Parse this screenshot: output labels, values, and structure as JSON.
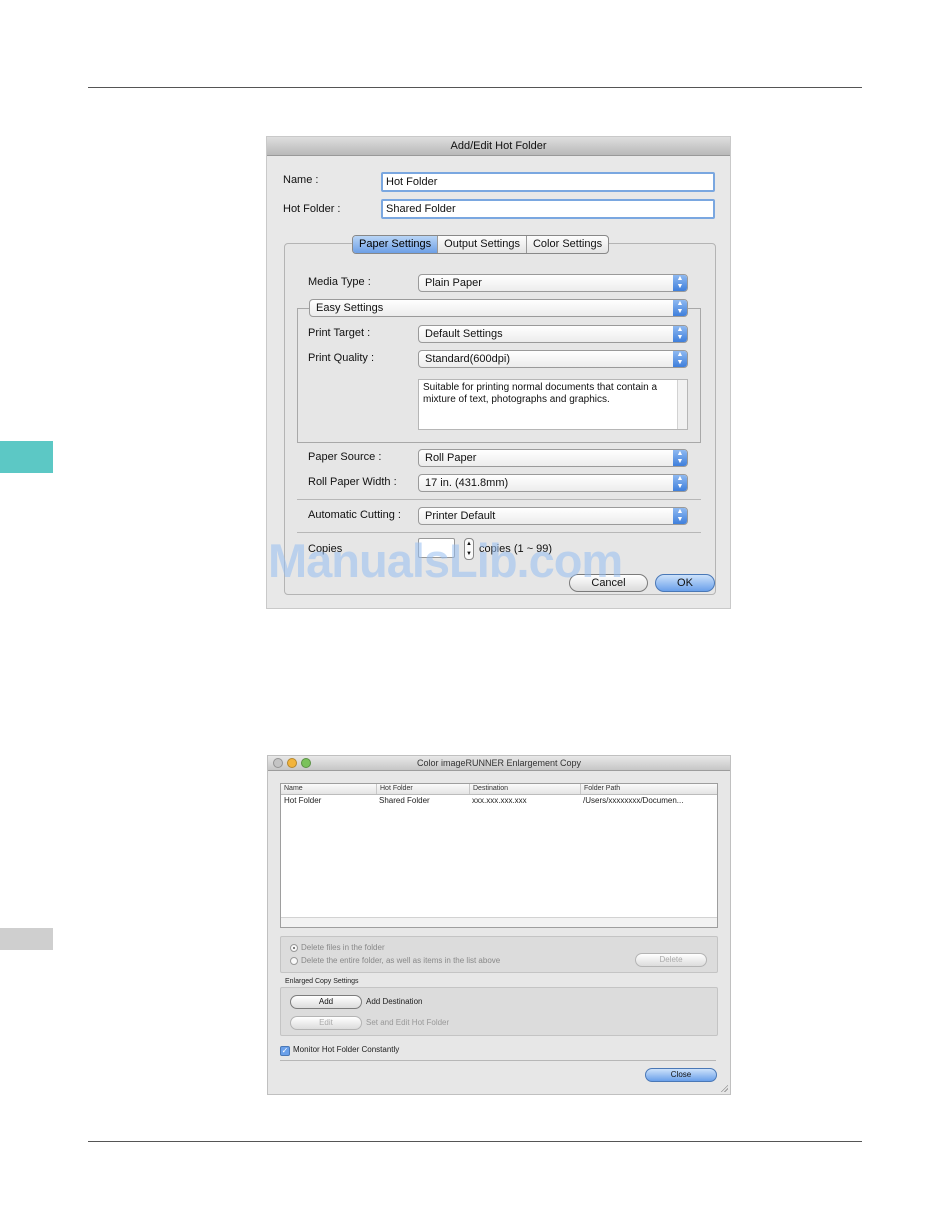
{
  "dialog1": {
    "title": "Add/Edit Hot Folder",
    "name_label": "Name :",
    "name_value": "Hot Folder",
    "hotfolder_label": "Hot Folder :",
    "hotfolder_value": "Shared Folder",
    "tabs": [
      "Paper Settings",
      "Output Settings",
      "Color Settings"
    ],
    "media_type_label": "Media Type :",
    "media_type_value": "Plain Paper",
    "easy_settings_value": "Easy Settings",
    "print_target_label": "Print Target :",
    "print_target_value": "Default Settings",
    "print_quality_label": "Print Quality :",
    "print_quality_value": "Standard(600dpi)",
    "description": "Suitable for printing normal documents that contain a mixture of text, photographs and graphics.",
    "paper_source_label": "Paper Source :",
    "paper_source_value": "Roll Paper",
    "roll_width_label": "Roll Paper Width :",
    "roll_width_value": "17 in. (431.8mm)",
    "auto_cut_label": "Automatic Cutting :",
    "auto_cut_value": "Printer Default",
    "copies_label": "Copies",
    "copies_value": "",
    "copies_range": "copies (1 ~ 99)",
    "cancel_label": "Cancel",
    "ok_label": "OK"
  },
  "watermark": "ManualsLib.com",
  "window2": {
    "title": "Color imageRUNNER Enlargement Copy",
    "columns": [
      "Name",
      "Hot Folder",
      "Destination",
      "Folder Path"
    ],
    "rows": [
      {
        "name": "Hot Folder",
        "hot_folder": "Shared Folder",
        "destination": "xxx.xxx.xxx.xxx",
        "folder_path": "/Users/xxxxxxxx/Documen..."
      }
    ],
    "radio_delete_files": "Delete files in the folder",
    "radio_delete_entire": "Delete the entire folder, as well as items in the list above",
    "delete_label": "Delete",
    "section_label": "Enlarged Copy Settings",
    "add_label": "Add",
    "add_desc": "Add Destination",
    "edit_label": "Edit",
    "edit_desc": "Set and Edit Hot Folder",
    "monitor_label": "Monitor Hot Folder Constantly",
    "close_label": "Close"
  },
  "colors": {
    "accent": "#6aa0ea",
    "active_side_tab": "#5cc8c5"
  }
}
